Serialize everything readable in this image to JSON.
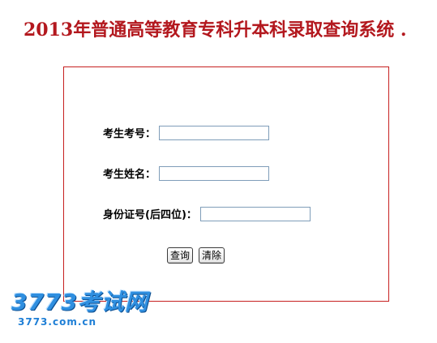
{
  "page": {
    "title": "2013年普通高等教育专科升本科录取查询系统 ."
  },
  "form": {
    "exam_number": {
      "label": "考生考号",
      "colon": "：",
      "value": ""
    },
    "student_name": {
      "label": "考生姓名",
      "colon": "：",
      "value": ""
    },
    "id_last4": {
      "label": "身份证号(后四位)",
      "colon": "：",
      "value": ""
    },
    "buttons": {
      "query_label": "查询",
      "clear_label": "清除"
    }
  },
  "watermark": {
    "brand_text": "3773考试网",
    "domain_text": "3773.com.cn"
  },
  "colors": {
    "title": "#b3181e",
    "frame_border": "#c62020",
    "watermark": "#2f8fe0"
  }
}
